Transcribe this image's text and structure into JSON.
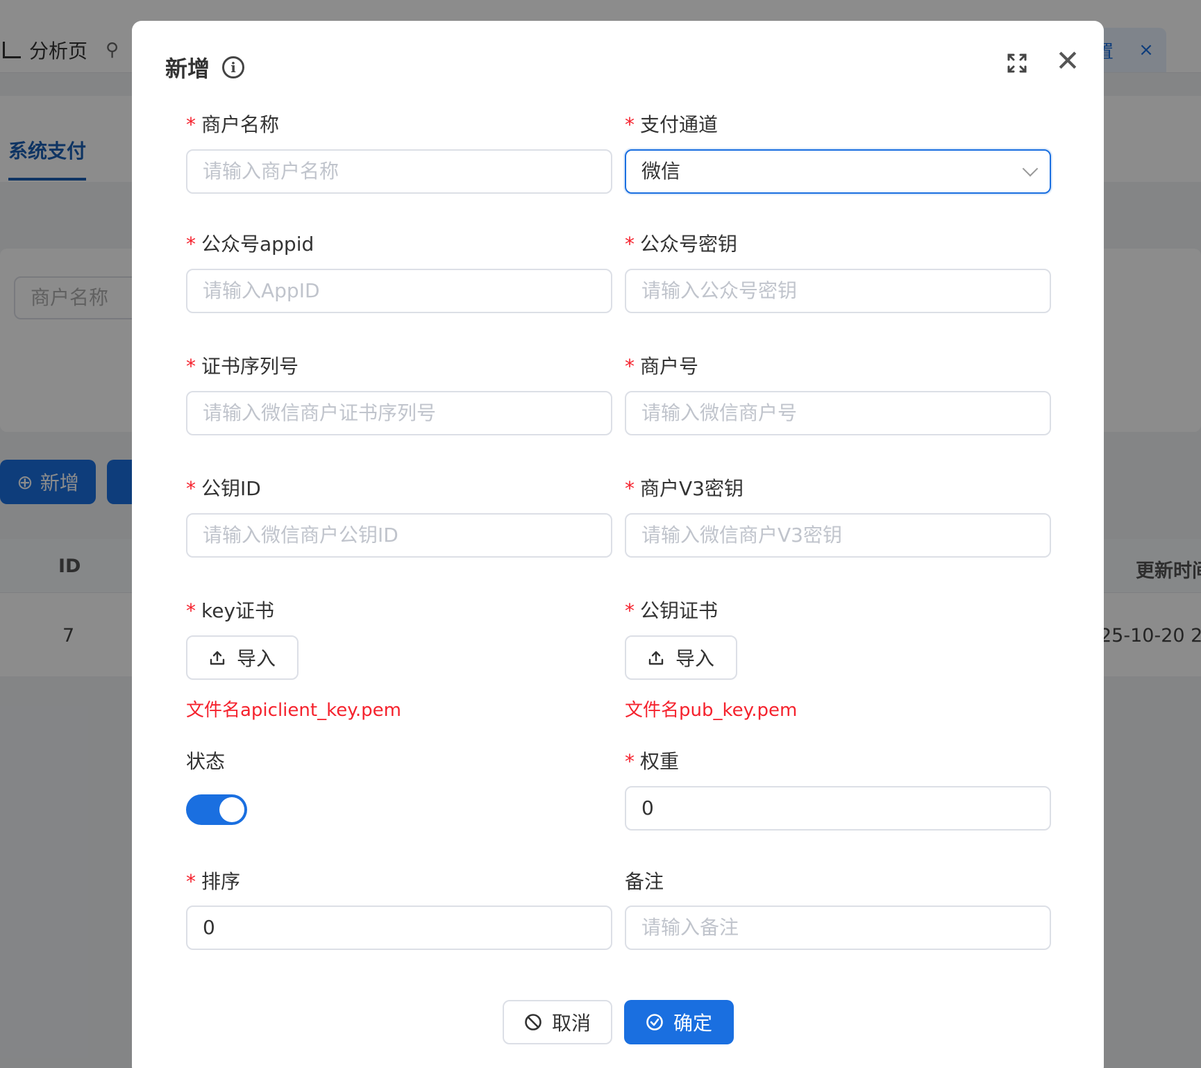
{
  "background": {
    "tab_label": "分析页",
    "tab_right_label": "置",
    "tab_right_close": "×",
    "section_tab": "系统支付",
    "search_placeholder": "商户名称",
    "add_button": "新增",
    "table": {
      "headers": [
        "ID",
        "更新时间"
      ],
      "row": {
        "id": "7",
        "time": "25-10-20 2"
      }
    }
  },
  "modal": {
    "title": "新增",
    "fields": {
      "merchant_name": {
        "label": "商户名称",
        "placeholder": "请输入商户名称"
      },
      "channel": {
        "label": "支付通道",
        "value": "微信"
      },
      "appid": {
        "label": "公众号appid",
        "placeholder": "请输入AppID"
      },
      "mp_secret": {
        "label": "公众号密钥",
        "placeholder": "请输入公众号密钥"
      },
      "cert_serial": {
        "label": "证书序列号",
        "placeholder": "请输入微信商户证书序列号"
      },
      "merchant_no": {
        "label": "商户号",
        "placeholder": "请输入微信商户号"
      },
      "pubkey_id": {
        "label": "公钥ID",
        "placeholder": "请输入微信商户公钥ID"
      },
      "v3_key": {
        "label": "商户V3密钥",
        "placeholder": "请输入微信商户V3密钥"
      },
      "key_cert": {
        "label": "key证书",
        "button": "导入",
        "hint": "文件名apiclient_key.pem"
      },
      "pub_cert": {
        "label": "公钥证书",
        "button": "导入",
        "hint": "文件名pub_key.pem"
      },
      "status": {
        "label": "状态",
        "on": true
      },
      "weight": {
        "label": "权重",
        "value": "0"
      },
      "sort": {
        "label": "排序",
        "value": "0"
      },
      "remark": {
        "label": "备注",
        "placeholder": "请输入备注"
      }
    },
    "buttons": {
      "cancel": "取消",
      "confirm": "确定"
    }
  },
  "colors": {
    "primary": "#1a6fe0",
    "required": "#f5222d",
    "mask": "rgba(0,0,0,0.45)"
  }
}
